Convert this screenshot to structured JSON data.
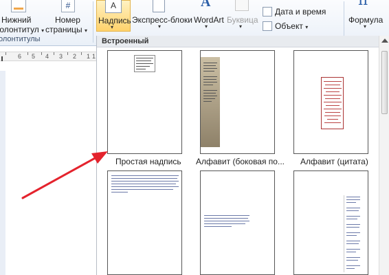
{
  "ribbon": {
    "footer_button": {
      "line1": "Нижний",
      "line2": "колонтитул"
    },
    "page_number_button": {
      "line1": "Номер",
      "line2": "страницы"
    },
    "group_header_footer_label": "олонтитулы",
    "textbox_button": {
      "label": "Надпись"
    },
    "quick_parts_button": {
      "label": "Экспресс-блоки"
    },
    "wordart_button": {
      "label": "WordArt",
      "icon_glyph": "A"
    },
    "dropcap_button": {
      "label": "Буквица"
    },
    "date_time_button": {
      "label": "Дата и время"
    },
    "object_button": {
      "label": "Объект"
    },
    "formula_button": {
      "label": "Формула",
      "icon_glyph": "π"
    },
    "page_number_glyph": "#",
    "textbox_glyph": "A",
    "dropdown_glyph": "▾"
  },
  "ruler": {
    "numbers": [
      "6",
      "5",
      "4",
      "3",
      "2",
      "1"
    ],
    "prefix": "1"
  },
  "gallery": {
    "section_title": "Встроенный",
    "items": [
      {
        "caption": "Простая надпись"
      },
      {
        "caption": "Алфавит (боковая по..."
      },
      {
        "caption": "Алфавит (цитата)"
      },
      {
        "caption": ""
      },
      {
        "caption": ""
      },
      {
        "caption": ""
      }
    ]
  },
  "colors": {
    "selected_button_bg": "#ffd26b",
    "arrow": "#e4232d",
    "ribbon_bg": "#eaf0f8"
  }
}
